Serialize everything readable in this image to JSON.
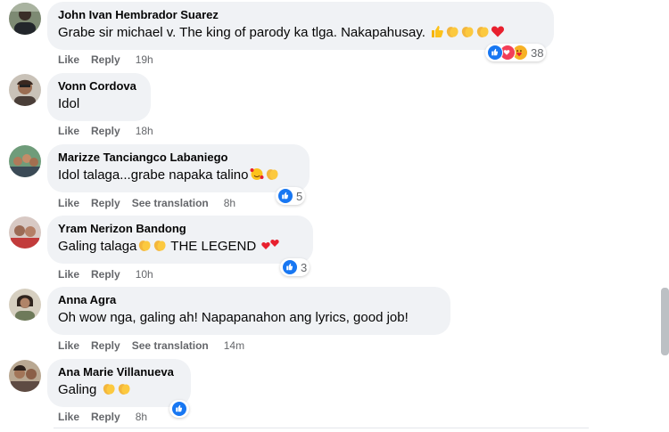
{
  "colors": {
    "bubble_bg": "#f0f2f5",
    "like_blue": "#1877f2",
    "love_red": "#f33e58",
    "secondary_text": "#65676b"
  },
  "comments": [
    {
      "author": "John Ivan Hembrador Suarez",
      "text": "Grabe sir michael v. The king of parody ka tlga. Nakapahusay.",
      "emoji": [
        "thumbs-up-icon",
        "clap-icon",
        "clap-icon",
        "clap-icon",
        "red-heart-icon"
      ],
      "like": "Like",
      "reply": "Reply",
      "time": "19h",
      "reactions": [
        "like-reaction-icon",
        "love-reaction-icon",
        "care-reaction-icon"
      ],
      "reaction_count": "38"
    },
    {
      "author": "Vonn Cordova",
      "text": "Idol",
      "emoji": [],
      "like": "Like",
      "reply": "Reply",
      "time": "18h"
    },
    {
      "author": "Marizze Tanciangco Labaniego",
      "text": "Idol talaga...grabe napaka talino",
      "emoji": [
        "smiling-face-with-hearts-icon",
        "clap-icon"
      ],
      "like": "Like",
      "reply": "Reply",
      "see_translation": "See translation",
      "time": "8h",
      "reactions": [
        "like-reaction-icon"
      ],
      "reaction_count": "5"
    },
    {
      "author": "Yram Nerizon Bandong",
      "text_before": "Galing talaga",
      "text_after": " THE LEGEND ",
      "emoji": [
        "clap-icon",
        "clap-icon"
      ],
      "emoji_after": [
        "hearts-icon"
      ],
      "like": "Like",
      "reply": "Reply",
      "time": "10h",
      "reactions": [
        "like-reaction-icon"
      ],
      "reaction_count": "3"
    },
    {
      "author": "Anna Agra",
      "text": "Oh wow nga, galing ah! Napapanahon ang lyrics, good job!",
      "emoji": [],
      "like": "Like",
      "reply": "Reply",
      "see_translation": "See translation",
      "time": "14m"
    },
    {
      "author": "Ana Marie Villanueva",
      "text": "Galing ",
      "emoji": [
        "clap-icon",
        "clap-icon"
      ],
      "like": "Like",
      "reply": "Reply",
      "time": "8h",
      "reactions": [
        "like-reaction-icon"
      ],
      "reaction_count": ""
    }
  ]
}
